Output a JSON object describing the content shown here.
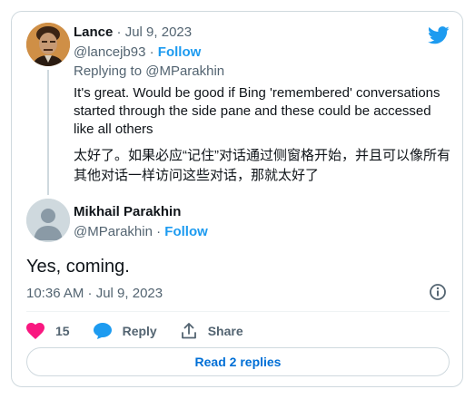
{
  "tweet1": {
    "name": "Lance",
    "separator": "·",
    "date": "Jul 9, 2023",
    "handle": "@lancejb93",
    "follow_label": "Follow",
    "replying_prefix": "Replying to",
    "replying_to": "@MParakhin",
    "text": "It's great. Would be good if Bing 'remembered' conversations started through the side pane and these could be accessed like all others",
    "translation": "太好了。如果必应“记住”对话通过侧窗格开始，并且可以像所有其他对话一样访问这些对话，那就太好了"
  },
  "tweet2": {
    "name": "Mikhail Parakhin",
    "handle": "@MParakhin",
    "follow_label": "Follow",
    "text": "Yes, coming.",
    "timestamp": "10:36 AM · Jul 9, 2023"
  },
  "actions": {
    "like_count": "15",
    "reply_label": "Reply",
    "share_label": "Share"
  },
  "read_replies_label": "Read 2 replies",
  "colors": {
    "accent": "#1d9bf0",
    "like": "#f91880",
    "muted": "#536471"
  },
  "icons": [
    "twitter-logo",
    "info-icon",
    "heart-icon",
    "reply-bubble-icon",
    "share-icon"
  ]
}
